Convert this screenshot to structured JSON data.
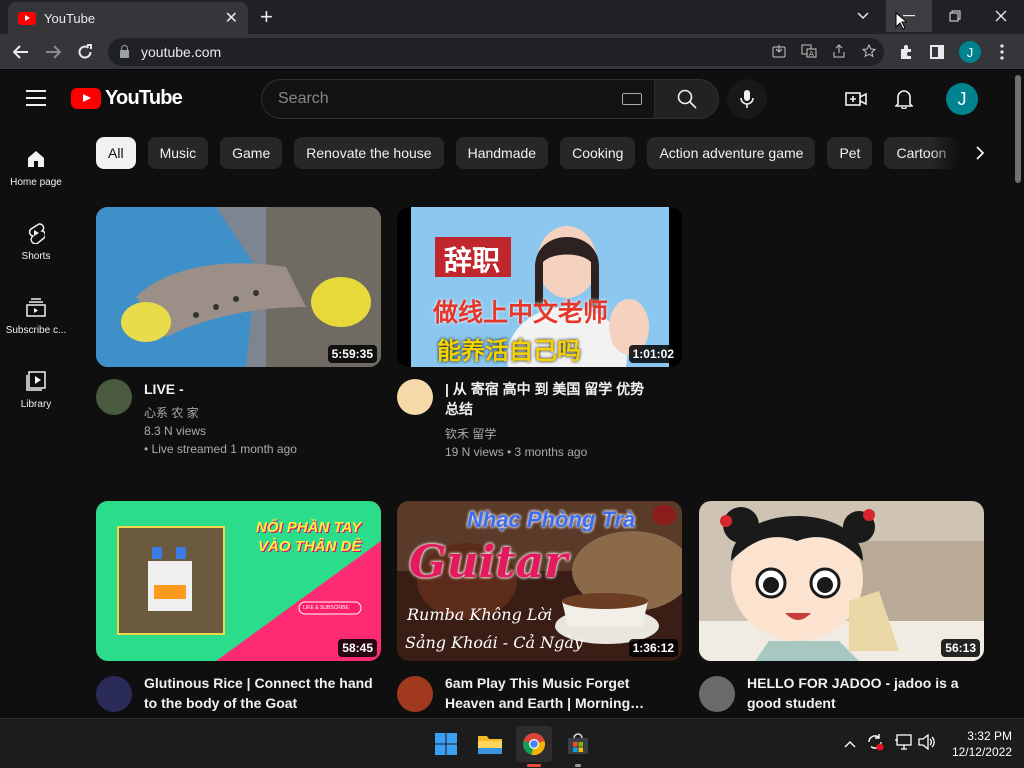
{
  "browser": {
    "tab_title": "YouTube",
    "tab_close": "✕",
    "new_tab": "+",
    "url": "youtube.com",
    "profile_initial": "J"
  },
  "youtube": {
    "logo_text": "YouTube",
    "search_placeholder": "Search",
    "avatar_initial": "J",
    "sidebar": [
      {
        "label": "Home page",
        "icon": "home-icon"
      },
      {
        "label": "Shorts",
        "icon": "shorts-icon"
      },
      {
        "label": "Subscribe c...",
        "icon": "subscriptions-icon"
      },
      {
        "label": "Library",
        "icon": "library-icon"
      }
    ],
    "chips": [
      "All",
      "Music",
      "Game",
      "Renovate the house",
      "Handmade",
      "Cooking",
      "Action adventure game",
      "Pet",
      "Cartoon"
    ],
    "videos": [
      {
        "title": "LIVE -",
        "channel": "心系 农 家",
        "views": "8.3 N views",
        "age": "• Live streamed 1 month ago",
        "duration": "5:59:35"
      },
      {
        "title": "| 从 寄宿 高中 到 美国 留学 优势 总结",
        "channel": "钦禾 留学",
        "views": "19 N views • 3 months ago",
        "age": "",
        "duration": "1:01:02",
        "thumb_text": [
          "辞职",
          "做线上中文老师",
          "能养活自己吗"
        ]
      },
      {
        "title": "Glutinous Rice | Connect the hand to the body of the Goat",
        "duration": "58:45",
        "thumb_text": [
          "NỐI PHẦN TAY",
          "VÀO THÂN DÊ",
          "LIKE & SUBSCRIBE"
        ]
      },
      {
        "title": "6am Play This Music Forget Heaven and Earth | Morning…",
        "duration": "1:36:12",
        "thumb_text": [
          "Nhạc Phòng Trà",
          "Guitar",
          "Rumba Không Lời",
          "Sảng Khoái - Cả Ngày"
        ]
      },
      {
        "title": "HELLO FOR JADOO - jadoo is a good student",
        "duration": "56:13"
      }
    ]
  },
  "taskbar": {
    "time": "3:32 PM",
    "date": "12/12/2022"
  }
}
